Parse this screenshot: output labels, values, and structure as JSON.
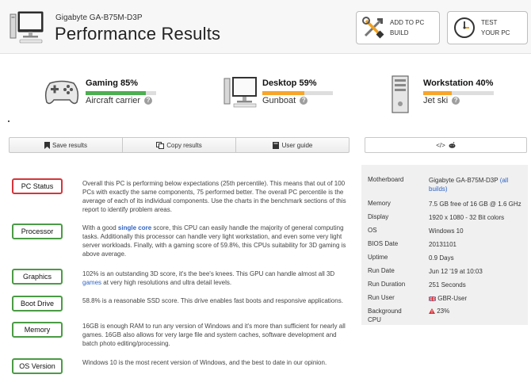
{
  "header": {
    "subtitle": "Gigabyte GA-B75M-D3P",
    "title": "Performance Results",
    "add_btn_line1": "ADD TO PC",
    "add_btn_line2": "BUILD",
    "test_btn_line1": "TEST",
    "test_btn_line2": "YOUR PC"
  },
  "scores": [
    {
      "name": "Gaming 85%",
      "value": 85,
      "fill_color": "#4caf50",
      "desc": "Aircraft carrier",
      "icon": "gamepad-icon"
    },
    {
      "name": "Desktop 59%",
      "value": 59,
      "fill_color": "#f7a52b",
      "desc": "Gunboat",
      "icon": "desktop-icon"
    },
    {
      "name": "Workstation 40%",
      "value": 40,
      "fill_color": "#f7a52b",
      "desc": "Jet ski",
      "icon": "tower-icon"
    }
  ],
  "actions": {
    "save": "Save results",
    "copy": "Copy results",
    "guide": "User guide",
    "share_glyph": "</>"
  },
  "results": [
    {
      "label": "PC Status",
      "color": "red",
      "text": "Overall this PC is performing below expectations (25th percentile). This means that out of 100 PCs with exactly the same components, 75 performed better. The overall PC percentile is the average of each of its individual components. Use the charts in the benchmark sections of this report to identify problem areas."
    },
    {
      "label": "Processor",
      "color": "green",
      "text_pre": "With a good ",
      "text_link": "single core",
      "text_post": " score, this CPU can easily handle the majority of general computing tasks. Additionally this processor can handle very light workstation, and even some very light server workloads. Finally, with a gaming score of 59.8%, this CPUs suitability for 3D gaming is above average."
    },
    {
      "label": "Graphics",
      "color": "green",
      "text_pre": "102% is an outstanding 3D score, it's the bee's knees. This GPU can handle almost all 3D ",
      "text_link": "games",
      "text_post": " at very high resolutions and ultra detail levels."
    },
    {
      "label": "Boot Drive",
      "color": "green",
      "text": "58.8% is a reasonable SSD score. This drive enables fast boots and responsive applications."
    },
    {
      "label": "Memory",
      "color": "green",
      "text": "16GB is enough RAM to run any version of Windows and it's more than sufficient for nearly all games. 16GB also allows for very large file and system caches, software development and batch photo editing/processing."
    },
    {
      "label": "OS Version",
      "color": "green",
      "text": "Windows 10 is the most recent version of Windows, and the best to date in our opinion."
    }
  ],
  "info": {
    "motherboard_label": "Motherboard",
    "motherboard_value": "Gigabyte GA-B75M-D3P",
    "motherboard_link": "(all builds)",
    "memory_label": "Memory",
    "memory_value": "7.5 GB free of 16 GB @ 1.6 GHz",
    "display_label": "Display",
    "display_value": "1920 x 1080 - 32 Bit colors",
    "os_label": "OS",
    "os_value": "Windows 10",
    "bios_label": "BIOS Date",
    "bios_value": "20131101",
    "uptime_label": "Uptime",
    "uptime_value": "0.9 Days",
    "rundate_label": "Run Date",
    "rundate_value": "Jun 12 '19 at 10:03",
    "runduration_label": "Run Duration",
    "runduration_value": "251 Seconds",
    "runuser_label": "Run User",
    "runuser_value": "GBR-User",
    "background_label": "Background CPU",
    "background_value": "23%"
  }
}
